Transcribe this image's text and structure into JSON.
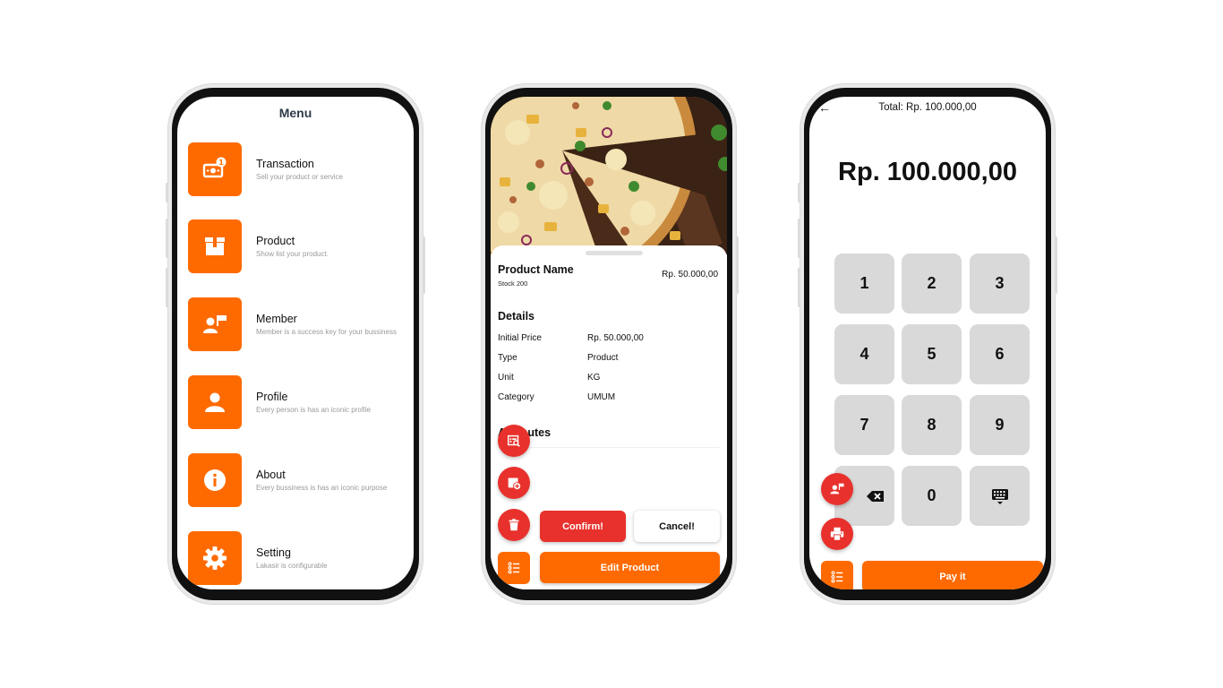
{
  "menu_screen": {
    "title": "Menu",
    "items": [
      {
        "label": "Transaction",
        "subtitle": "Sell your product or service",
        "icon": "money-icon"
      },
      {
        "label": "Product",
        "subtitle": "Show list your product.",
        "icon": "box-icon"
      },
      {
        "label": "Member",
        "subtitle": "Member is a success key for your  bussiness",
        "icon": "member-icon"
      },
      {
        "label": "Profile",
        "subtitle": "Every person is has an iconic profile",
        "icon": "person-icon"
      },
      {
        "label": "About",
        "subtitle": "Every bussiness is has an iconic purpose",
        "icon": "info-icon"
      },
      {
        "label": "Setting",
        "subtitle": "Lakasir is configurable",
        "icon": "gear-icon"
      }
    ]
  },
  "product_screen": {
    "name": "Product Name",
    "stock": "Stock 200",
    "price": "Rp. 50.000,00",
    "details_heading": "Details",
    "details": [
      {
        "key": "Initial Price",
        "value": "Rp. 50.000,00"
      },
      {
        "key": "Type",
        "value": "Product"
      },
      {
        "key": "Unit",
        "value": "KG"
      },
      {
        "key": "Category",
        "value": "UMUM"
      }
    ],
    "attributes_heading": "Attributes",
    "confirm_label": "Confirm!",
    "cancel_label": "Cancel!",
    "edit_label": "Edit Product"
  },
  "payment_screen": {
    "total_label": "Total: Rp. 100.000,00",
    "amount": "Rp. 100.000,00",
    "keys": [
      "1",
      "2",
      "3",
      "4",
      "5",
      "6",
      "7",
      "8",
      "9",
      "0"
    ],
    "pay_label": "Pay it"
  },
  "colors": {
    "accent": "#ff6a00",
    "danger": "#e8312c",
    "key_bg": "#d9d9d9"
  }
}
